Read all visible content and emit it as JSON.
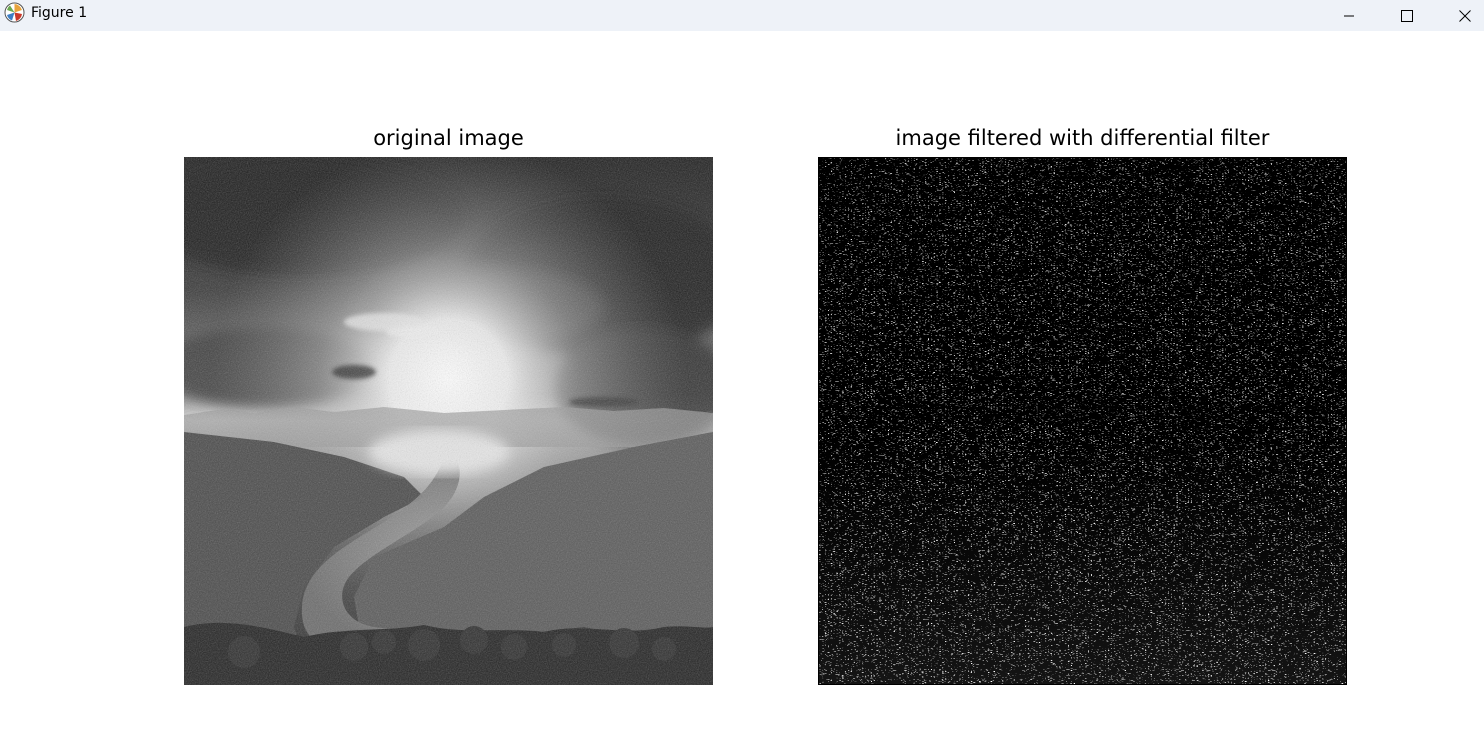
{
  "window": {
    "title": "Figure 1",
    "app_icon": "matplotlib-icon",
    "controls": {
      "minimize_icon": "minimize-icon",
      "maximize_icon": "maximize-icon",
      "close_icon": "close-icon"
    }
  },
  "figure": {
    "left_plot": {
      "title": "original image",
      "content": "grayscale-photo"
    },
    "right_plot": {
      "title": "image filtered with differential filter",
      "content": "binary-noise-edge-map"
    }
  }
}
